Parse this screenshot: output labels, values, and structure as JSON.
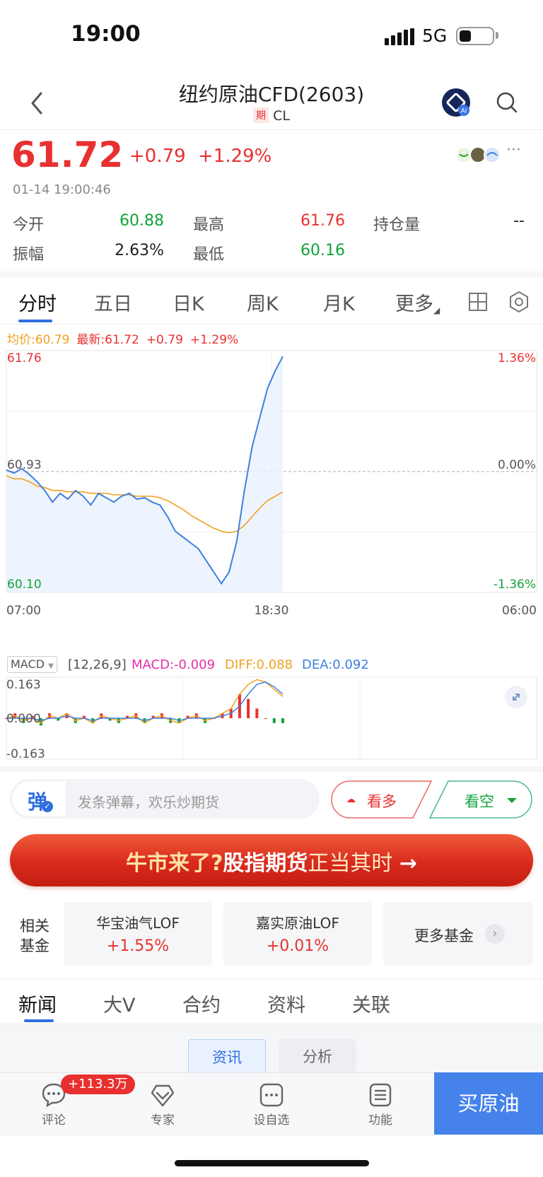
{
  "status_bar": {
    "time": "19:00",
    "network": "5G"
  },
  "header": {
    "title": "纽约原油CFD(2603)",
    "badge": "期",
    "subtitle": "CL"
  },
  "quote": {
    "price": "61.72",
    "change": "+0.79",
    "change_pct": "+1.29%",
    "timestamp": "01-14 19:00:46",
    "stats": [
      {
        "label": "今开",
        "value": "60.88",
        "color": "#12a339"
      },
      {
        "label": "最高",
        "value": "61.76",
        "color": "#e93030"
      },
      {
        "label": "持仓量",
        "value": "--",
        "color": "#222222"
      },
      {
        "label": "振幅",
        "value": "2.63%",
        "color": "#222222"
      },
      {
        "label": "最低",
        "value": "60.16",
        "color": "#12a339"
      }
    ]
  },
  "chart_tabs": [
    "分时",
    "五日",
    "日K",
    "周K",
    "月K",
    "更多"
  ],
  "chart_legend": {
    "avg": "均价:60.79",
    "latest": "最新:61.72",
    "change": "+0.79",
    "change_pct": "+1.29%"
  },
  "chart_data": {
    "type": "line",
    "y_labels_left": [
      "61.76",
      "60.93",
      "60.10"
    ],
    "y_labels_right": [
      "1.36%",
      "0.00%",
      "-1.36%"
    ],
    "x_labels": [
      "07:00",
      "18:30",
      "06:00"
    ],
    "ylim": [
      60.1,
      61.76
    ],
    "reference": 60.93,
    "series": [
      {
        "values": [
          60.94,
          60.92,
          60.95,
          60.91,
          60.86,
          60.8,
          60.72,
          60.78,
          60.74,
          60.8,
          60.76,
          60.7,
          60.78,
          60.75,
          60.72,
          60.76,
          60.78,
          60.74,
          60.75,
          60.72,
          60.7,
          60.62,
          60.52,
          60.48,
          60.44,
          60.4,
          60.32,
          60.24,
          60.16,
          60.24,
          60.45,
          60.8,
          61.1,
          61.3,
          61.5,
          61.62,
          61.72
        ]
      },
      {
        "values": [
          60.9,
          60.88,
          60.88,
          60.86,
          60.83,
          60.82,
          60.8,
          60.8,
          60.79,
          60.79,
          60.79,
          60.78,
          60.78,
          60.78,
          60.77,
          60.77,
          60.77,
          60.76,
          60.76,
          60.76,
          60.75,
          60.73,
          60.7,
          60.67,
          60.63,
          60.6,
          60.57,
          60.54,
          60.52,
          60.51,
          60.52,
          60.56,
          60.62,
          60.68,
          60.73,
          60.76,
          60.79
        ]
      }
    ]
  },
  "macd": {
    "name": "MACD",
    "params": "[12,26,9]",
    "macd": "MACD:-0.009",
    "diff": "DIFF:0.088",
    "dea": "DEA:0.092",
    "y_labels": [
      "0.163",
      "0.000",
      "-0.163"
    ],
    "diff_values": [
      0.0,
      0.01,
      -0.01,
      0.0,
      -0.02,
      0.01,
      0.0,
      0.02,
      -0.01,
      0.0,
      -0.02,
      0.01,
      0.0,
      -0.01,
      0.0,
      0.01,
      -0.02,
      0.0,
      0.01,
      -0.01,
      -0.02,
      0.0,
      0.01,
      -0.01,
      0.0,
      0.02,
      0.04,
      0.1,
      0.14,
      0.16,
      0.15,
      0.12,
      0.09
    ],
    "dea_values": [
      0.0,
      0.0,
      0.0,
      0.0,
      -0.01,
      0.0,
      0.0,
      0.01,
      0.0,
      0.0,
      -0.01,
      0.0,
      0.0,
      0.0,
      0.0,
      0.0,
      -0.01,
      0.0,
      0.0,
      0.0,
      -0.01,
      0.0,
      0.0,
      0.0,
      0.0,
      0.01,
      0.02,
      0.05,
      0.1,
      0.14,
      0.15,
      0.13,
      0.1
    ],
    "macd_bars": [
      0.0,
      0.02,
      -0.02,
      0.01,
      -0.03,
      0.02,
      -0.01,
      0.02,
      -0.02,
      0.01,
      -0.02,
      0.02,
      -0.01,
      -0.02,
      0.01,
      0.02,
      -0.02,
      0.01,
      0.02,
      -0.02,
      -0.02,
      0.01,
      0.02,
      -0.02,
      0.0,
      0.02,
      0.04,
      0.1,
      0.08,
      0.04,
      0.0,
      -0.02,
      -0.02
    ]
  },
  "comment_bar": {
    "placeholder": "发条弹幕，欢乐炒期货",
    "bull": "看多",
    "bear": "看空"
  },
  "banner": {
    "part1": "牛市来了?",
    "part2": "股指期货",
    "part3": "正当其时",
    "arrow": "→"
  },
  "funds": {
    "label_line1": "相关",
    "label_line2": "基金",
    "items": [
      {
        "name": "华宝油气LOF",
        "pct": "+1.55%"
      },
      {
        "name": "嘉实原油LOF",
        "pct": "+0.01%"
      }
    ],
    "more": "更多基金"
  },
  "news_tabs": [
    "新闻",
    "大V",
    "合约",
    "资料",
    "关联"
  ],
  "news_subtabs": [
    "资讯",
    "分析"
  ],
  "bottom_bar": {
    "items": [
      "评论",
      "专家",
      "设自选",
      "功能"
    ],
    "badge": "+113.3万",
    "buy": "买原油"
  },
  "colors": {
    "up": "#e93030",
    "down": "#12a339",
    "accent": "#2f6fe0",
    "avg_line": "#f0a020",
    "price_line": "#3f7fe0"
  }
}
